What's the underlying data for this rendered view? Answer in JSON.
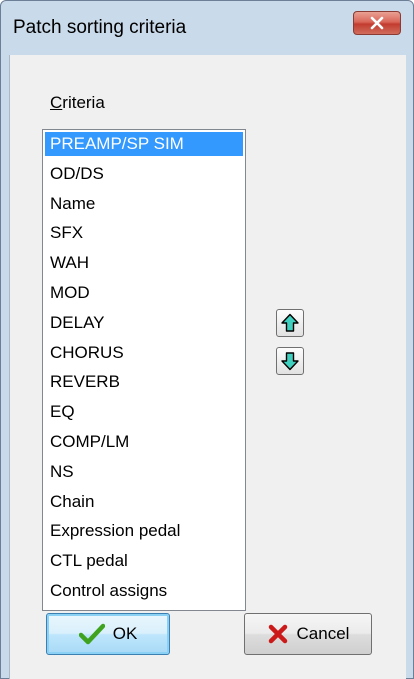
{
  "window": {
    "title": "Patch sorting criteria"
  },
  "criteria": {
    "label": "Criteria",
    "selected_index": 0,
    "items": [
      "PREAMP/SP SIM",
      "OD/DS",
      "Name",
      "SFX",
      "WAH",
      "MOD",
      "DELAY",
      "CHORUS",
      "REVERB",
      "EQ",
      "COMP/LM",
      "NS",
      "Chain",
      "Expression pedal",
      "CTL pedal",
      "Control assigns"
    ]
  },
  "buttons": {
    "ok": "OK",
    "cancel": "Cancel",
    "move_up_icon": "arrow-up-icon",
    "move_down_icon": "arrow-down-icon"
  },
  "colors": {
    "selection": "#3399ff",
    "arrow_fill": "#40d0c0",
    "ok_check": "#3fa31f",
    "cancel_x": "#cc1a1a",
    "close_button": "#c94a3d"
  }
}
